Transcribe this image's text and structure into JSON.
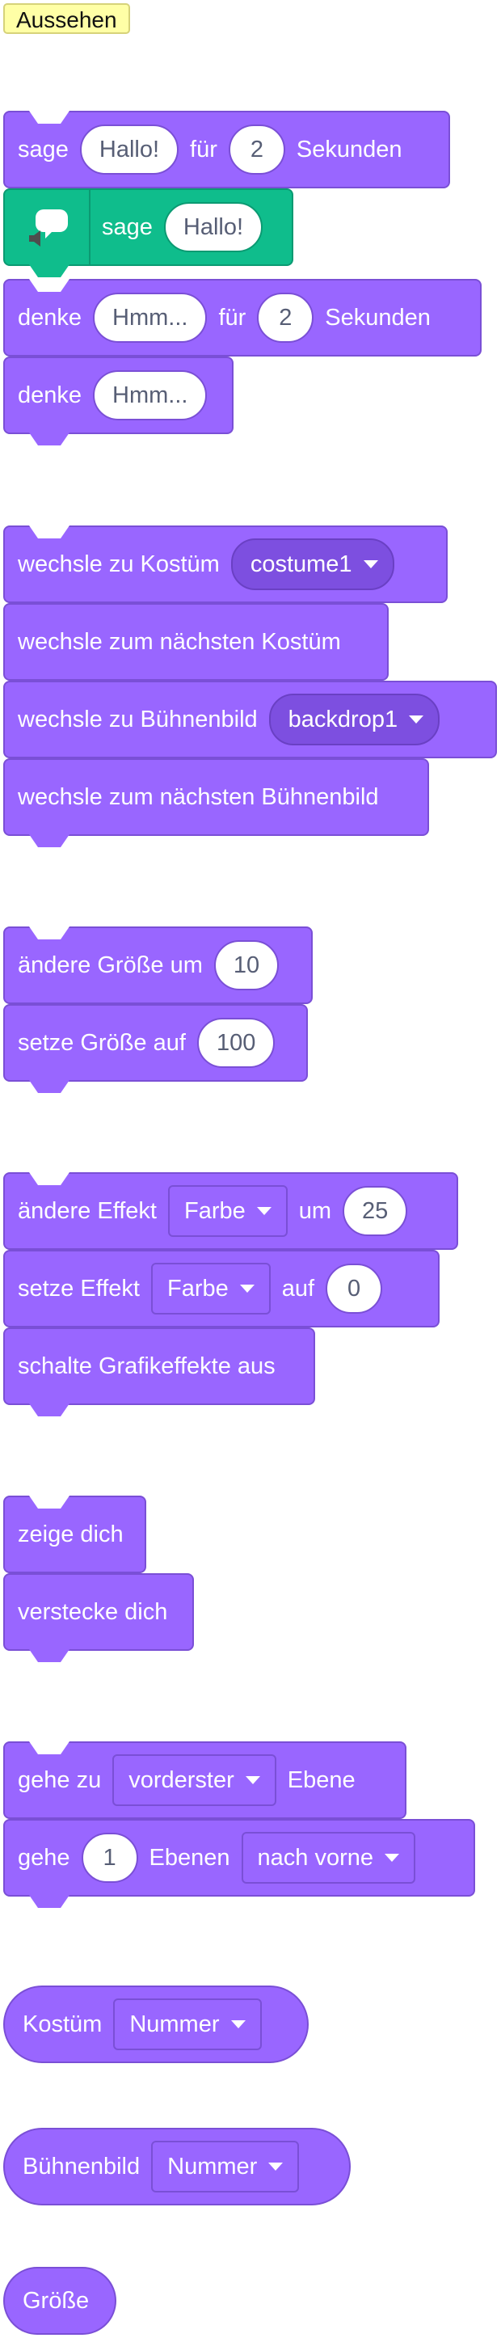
{
  "category": {
    "label": "Aussehen"
  },
  "colors": {
    "looks": "#9966ff",
    "looks_border": "#7a4fd6",
    "extension": "#0fbd8c",
    "category_bg": "#ffffa6"
  },
  "blocks": {
    "say_for": {
      "word1": "sage",
      "value1": "Hallo!",
      "word2": "für",
      "value2": "2",
      "word3": "Sekunden"
    },
    "tts_say": {
      "icon": "speech-bubble-speaker-icon",
      "word1": "sage",
      "value1": "Hallo!"
    },
    "think_for": {
      "word1": "denke",
      "value1": "Hmm...",
      "word2": "für",
      "value2": "2",
      "word3": "Sekunden"
    },
    "think": {
      "word1": "denke",
      "value1": "Hmm..."
    },
    "switch_costume": {
      "word1": "wechsle zu Kostüm",
      "value1": "costume1"
    },
    "next_costume": {
      "word1": "wechsle zum nächsten Kostüm"
    },
    "switch_backdrop": {
      "word1": "wechsle zu Bühnenbild",
      "value1": "backdrop1"
    },
    "next_backdrop": {
      "word1": "wechsle zum nächsten Bühnenbild"
    },
    "change_size": {
      "word1": "ändere Größe um",
      "value1": "10"
    },
    "set_size": {
      "word1": "setze Größe auf",
      "value1": "100"
    },
    "change_effect": {
      "word1": "ändere Effekt",
      "value1": "Farbe",
      "word2": "um",
      "value2": "25"
    },
    "set_effect": {
      "word1": "setze Effekt",
      "value1": "Farbe",
      "word2": "auf",
      "value2": "0"
    },
    "clear_effects": {
      "word1": "schalte Grafikeffekte aus"
    },
    "show": {
      "word1": "zeige dich"
    },
    "hide": {
      "word1": "verstecke dich"
    },
    "goto_layer": {
      "word1": "gehe zu",
      "value1": "vorderster",
      "word2": "Ebene"
    },
    "go_layers": {
      "word1": "gehe",
      "value1": "1",
      "word2": "Ebenen",
      "value2": "nach vorne"
    },
    "costume_rep": {
      "word1": "Kostüm",
      "value1": "Nummer"
    },
    "backdrop_rep": {
      "word1": "Bühnenbild",
      "value1": "Nummer"
    },
    "size_rep": {
      "word1": "Größe"
    }
  }
}
